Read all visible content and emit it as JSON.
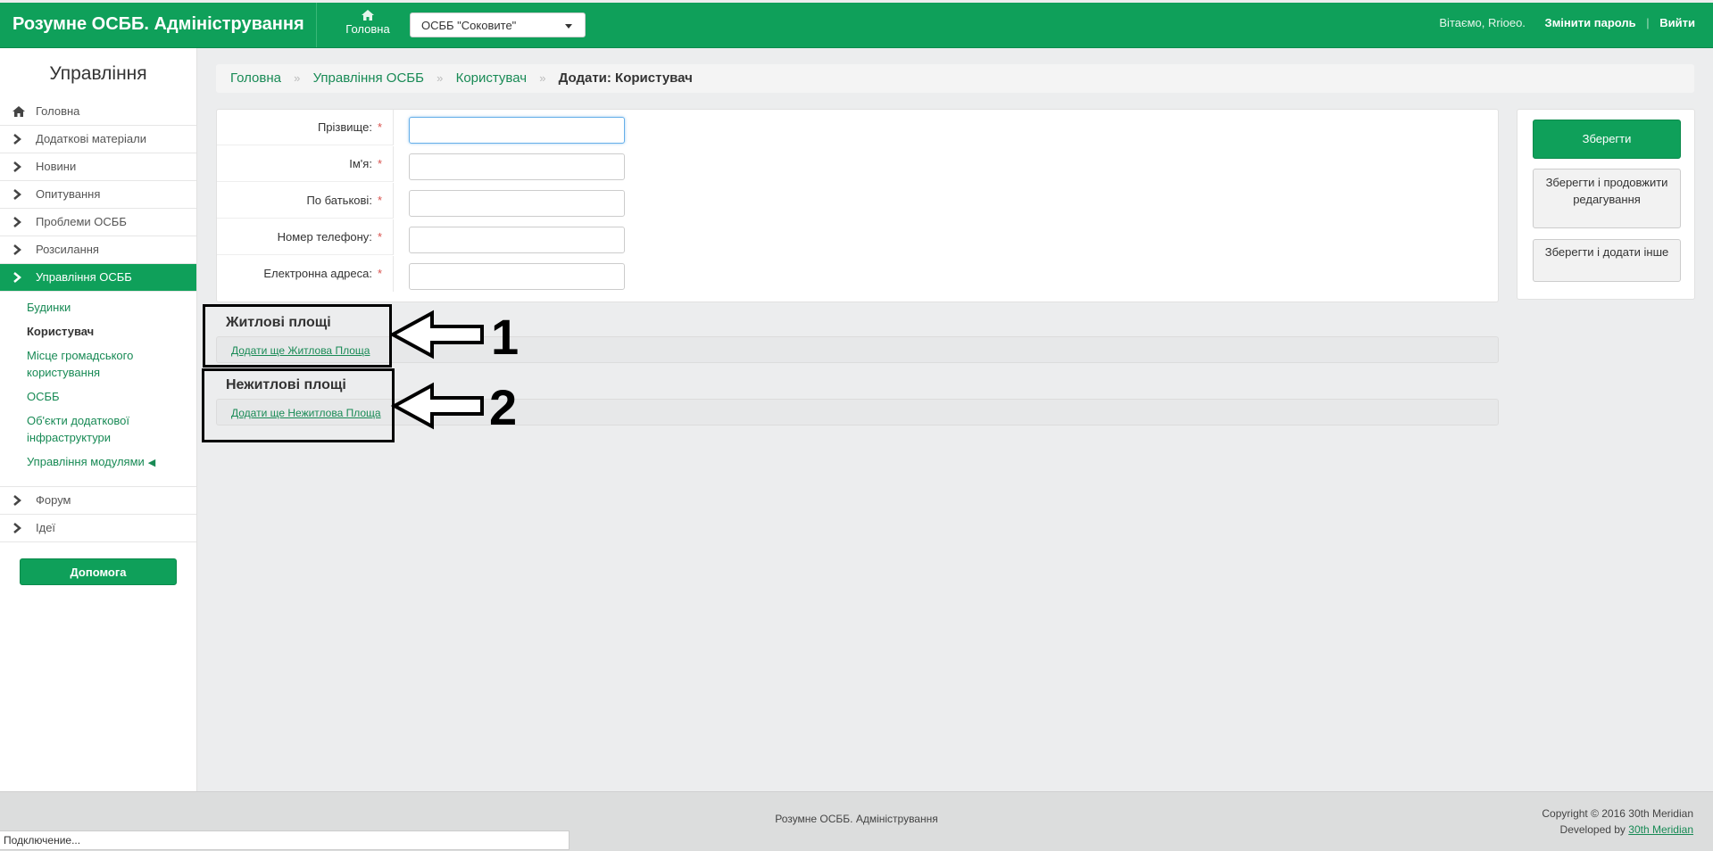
{
  "header": {
    "brand": "Розумне ОСББ. Адміністрування",
    "home_label": "Головна",
    "osbb_selected": "ОСББ \"Соковите\"",
    "greeting": "Вітаємо, Rrioeo.",
    "change_password": "Змінити пароль",
    "separator": "|",
    "logout": "Вийти",
    "accent_color": "#0fa05a"
  },
  "sidebar": {
    "title": "Управління",
    "items": [
      {
        "label": "Головна",
        "icon": "home-icon"
      },
      {
        "label": "Додаткові матеріали",
        "icon": "chevron-right-icon"
      },
      {
        "label": "Новини",
        "icon": "chevron-right-icon"
      },
      {
        "label": "Опитування",
        "icon": "chevron-right-icon"
      },
      {
        "label": "Проблеми ОСББ",
        "icon": "chevron-right-icon"
      },
      {
        "label": "Розсилання",
        "icon": "chevron-right-icon"
      },
      {
        "label": "Управління ОСББ",
        "icon": "chevron-right-icon",
        "active": true
      }
    ],
    "subitems": [
      {
        "label": "Будинки"
      },
      {
        "label": "Користувач",
        "current": true
      },
      {
        "label": "Місце громадського користування"
      },
      {
        "label": "ОСББ"
      },
      {
        "label": "Об'єкти додаткової інфраструктури"
      },
      {
        "label": "Управління модулями",
        "marker": "◀"
      }
    ],
    "items_after": [
      {
        "label": "Форум",
        "icon": "chevron-right-icon"
      },
      {
        "label": "Ідеї",
        "icon": "chevron-right-icon"
      }
    ],
    "help_button": "Допомога"
  },
  "breadcrumb": {
    "items": [
      "Головна",
      "Управління ОСББ",
      "Користувач"
    ],
    "current": "Додати: Користувач",
    "separator": "»"
  },
  "form": {
    "fields": [
      {
        "label": "Прізвище:",
        "required": "*",
        "value": ""
      },
      {
        "label": "Ім'я:",
        "required": "*",
        "value": ""
      },
      {
        "label": "По батькові:",
        "required": "*",
        "value": ""
      },
      {
        "label": "Номер телефону:",
        "required": "*",
        "value": ""
      },
      {
        "label": "Електронна адреса:",
        "required": "*",
        "value": ""
      }
    ]
  },
  "inlines": {
    "residential": {
      "title": "Житлові площі",
      "add_link": "Додати ще Житлова Площа"
    },
    "nonresidential": {
      "title": "Нежитлові площі",
      "add_link": "Додати ще Нежитлова Площа"
    }
  },
  "annotations": {
    "one": "1",
    "two": "2"
  },
  "actions": {
    "save": "Зберегти",
    "save_continue": "Зберегти і продовжити редагування",
    "save_add_another": "Зберегти і додати інше"
  },
  "footer": {
    "center": "Розумне ОСББ. Адміністрування",
    "copyright": "Copyright © 2016 30th Meridian",
    "developed_by": "Developed by",
    "developer_link": "30th Meridian"
  },
  "statusbar": {
    "text": "Подключение..."
  }
}
